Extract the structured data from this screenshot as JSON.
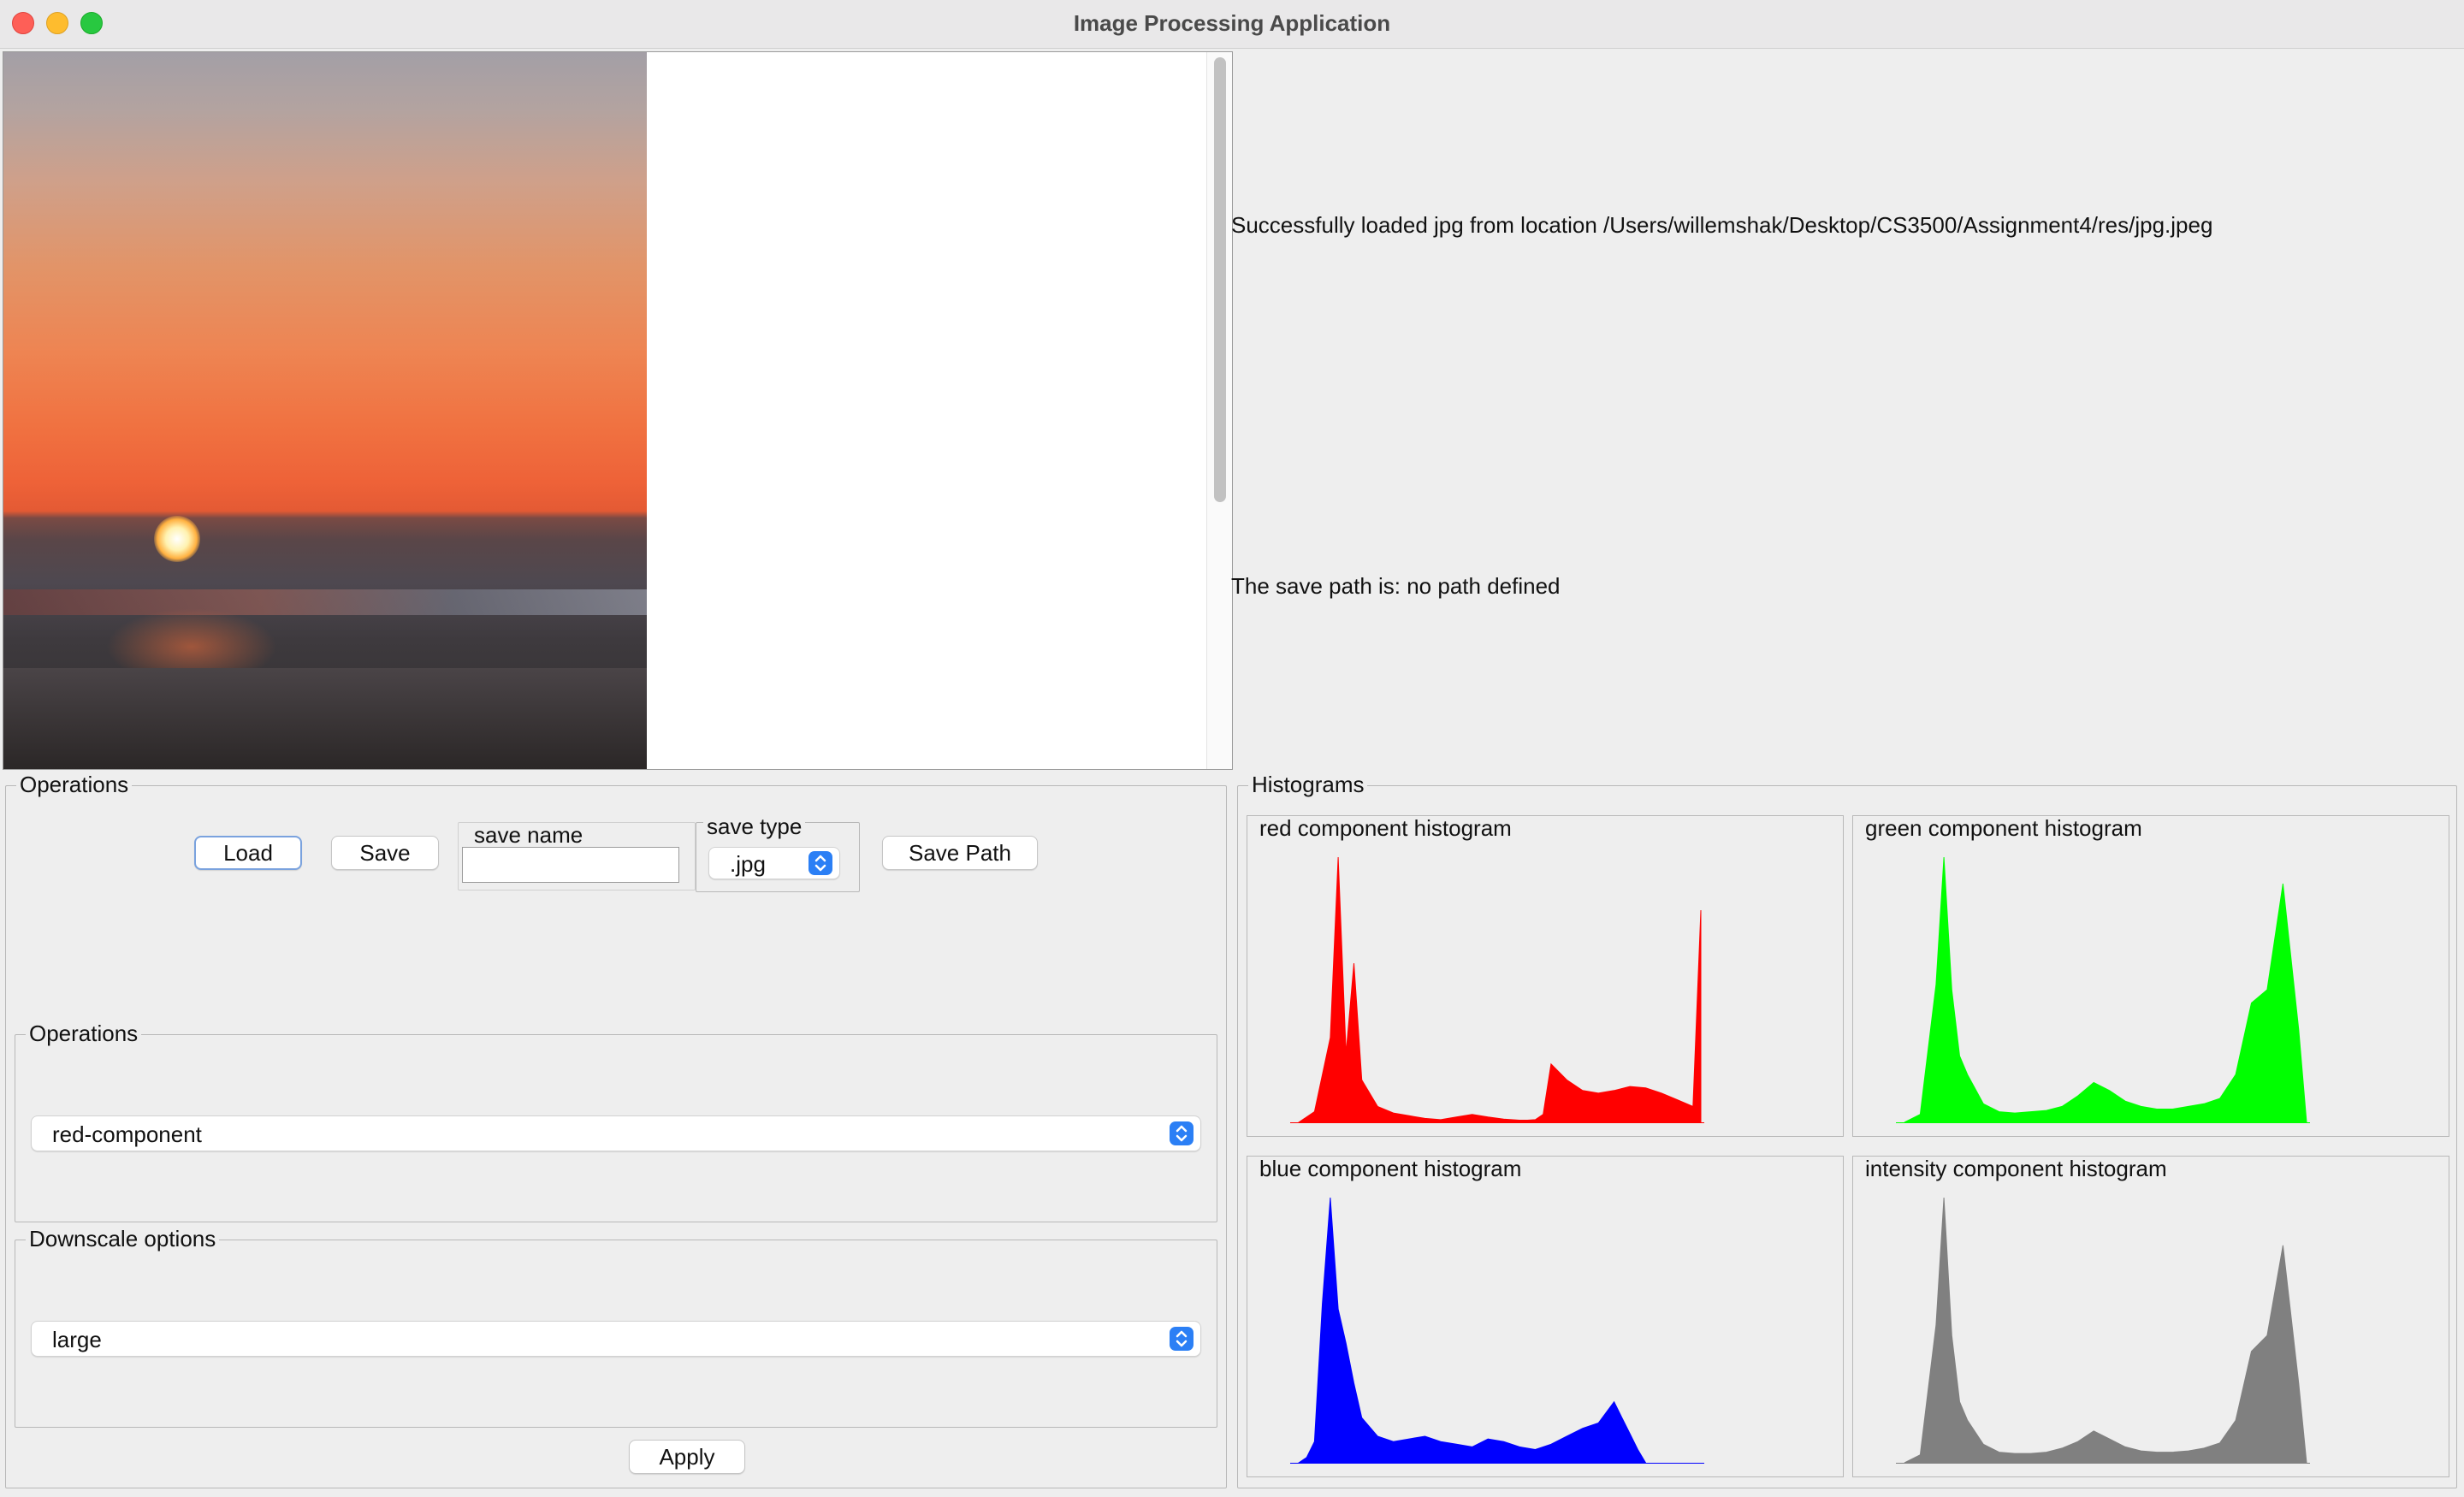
{
  "window": {
    "title": "Image Processing Application"
  },
  "messages": {
    "load_status": "Successfully loaded jpg from location /Users/willemshak/Desktop/CS3500/Assignment4/res/jpg.jpeg",
    "save_path_status": "The save path is: no path defined"
  },
  "operations_panel": {
    "title": "Operations",
    "load_label": "Load",
    "save_label": "Save",
    "save_name": {
      "label": "save name",
      "value": ""
    },
    "save_type": {
      "label": "save type",
      "selected": ".jpg"
    },
    "save_path_label": "Save Path",
    "operations_group": {
      "title": "Operations",
      "selected": "red-component"
    },
    "downscale_group": {
      "title": "Downscale options",
      "selected": "large"
    },
    "apply_label": "Apply"
  },
  "histograms_panel": {
    "title": "Histograms",
    "charts": [
      {
        "title": "red component histogram",
        "color": "#ff0000"
      },
      {
        "title": "green component histogram",
        "color": "#00ff00"
      },
      {
        "title": "blue component histogram",
        "color": "#0000ff"
      },
      {
        "title": "intensity component histogram",
        "color": "#808080"
      }
    ]
  },
  "chart_data": [
    {
      "type": "area",
      "title": "red component histogram",
      "color": "#ff0000",
      "x": [
        0,
        10,
        20,
        25,
        30,
        35,
        40,
        50,
        60,
        70,
        80,
        90,
        100,
        110,
        120,
        130,
        140,
        145,
        150,
        155,
        160,
        170,
        180,
        190,
        200,
        210,
        220,
        230,
        240,
        250,
        255
      ],
      "values": [
        0,
        40,
        320,
        1000,
        260,
        600,
        160,
        60,
        35,
        25,
        15,
        10,
        20,
        30,
        20,
        12,
        8,
        8,
        10,
        30,
        220,
        160,
        120,
        110,
        120,
        135,
        130,
        110,
        85,
        60,
        800
      ]
    },
    {
      "type": "area",
      "title": "green component histogram",
      "color": "#00ff00",
      "x": [
        0,
        10,
        20,
        25,
        30,
        35,
        40,
        50,
        60,
        70,
        80,
        90,
        100,
        110,
        120,
        130,
        140,
        150,
        160,
        170,
        180,
        190,
        200,
        210,
        220,
        230,
        240,
        250,
        255
      ],
      "values": [
        0,
        30,
        520,
        1000,
        500,
        250,
        180,
        70,
        40,
        35,
        40,
        45,
        60,
        100,
        150,
        120,
        80,
        60,
        50,
        50,
        60,
        70,
        90,
        180,
        450,
        500,
        900,
        350,
        0
      ]
    },
    {
      "type": "area",
      "title": "blue component histogram",
      "color": "#0000ff",
      "x": [
        0,
        5,
        10,
        15,
        20,
        25,
        30,
        35,
        40,
        50,
        60,
        70,
        80,
        90,
        100,
        110,
        120,
        130,
        140,
        150,
        160,
        170,
        180,
        190,
        200,
        205,
        210,
        215,
        220
      ],
      "values": [
        0,
        20,
        80,
        600,
        1000,
        580,
        450,
        300,
        170,
        100,
        80,
        90,
        100,
        80,
        70,
        60,
        90,
        80,
        60,
        50,
        70,
        100,
        130,
        150,
        230,
        170,
        110,
        50,
        0
      ]
    },
    {
      "type": "area",
      "title": "intensity component histogram",
      "color": "#808080",
      "x": [
        0,
        10,
        20,
        25,
        30,
        35,
        40,
        50,
        60,
        70,
        80,
        90,
        100,
        110,
        120,
        130,
        140,
        150,
        160,
        170,
        180,
        190,
        200,
        210,
        220,
        230,
        240,
        250,
        255
      ],
      "values": [
        0,
        30,
        520,
        1000,
        480,
        230,
        160,
        70,
        40,
        35,
        35,
        40,
        55,
        80,
        120,
        90,
        60,
        45,
        40,
        40,
        45,
        55,
        75,
        160,
        420,
        480,
        820,
        300,
        0
      ]
    }
  ]
}
